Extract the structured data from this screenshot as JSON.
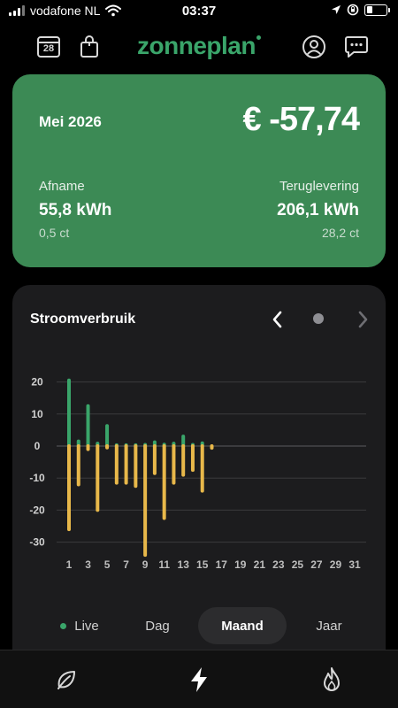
{
  "status_bar": {
    "carrier": "vodafone NL",
    "time": "03:37"
  },
  "header": {
    "calendar_day": "28",
    "logo": "zonneplan",
    "icons": [
      "calendar-icon",
      "shopping-bag-icon",
      "user-icon",
      "chat-icon"
    ]
  },
  "summary": {
    "month": "Mei 2026",
    "amount": "€ -57,74",
    "afname": {
      "label": "Afname",
      "value": "55,8 kWh",
      "sub": "0,5 ct"
    },
    "teruglevering": {
      "label": "Teruglevering",
      "value": "206,1 kWh",
      "sub": "28,2 ct"
    }
  },
  "chart": {
    "title": "Stroomverbruik"
  },
  "chart_data": {
    "type": "bar",
    "title": "Stroomverbruik",
    "x": [
      1,
      2,
      3,
      4,
      5,
      6,
      7,
      8,
      9,
      10,
      11,
      12,
      13,
      14,
      15,
      16,
      17,
      18,
      19,
      20,
      21,
      22,
      23,
      24,
      25,
      26,
      27,
      28,
      29,
      30,
      31
    ],
    "x_tick_labels": [
      "1",
      "3",
      "5",
      "7",
      "9",
      "11",
      "13",
      "15",
      "17",
      "19",
      "21",
      "23",
      "25",
      "27",
      "29",
      "31"
    ],
    "y_tick_labels": [
      "20",
      "10",
      "0",
      "-10",
      "-20",
      "-30"
    ],
    "ylim": [
      -35,
      22
    ],
    "grid": true,
    "colors": {
      "positive": "#3aa56a",
      "negative": "#e8b84a"
    },
    "series": [
      {
        "values": [
          20.5,
          1.5,
          12.5,
          0.8,
          6.3,
          0.3,
          0.3,
          0.3,
          0.4,
          1.2,
          0.5,
          0.8,
          3.0,
          0.4,
          0.9,
          0,
          null,
          null,
          null,
          null,
          null,
          null,
          null,
          null,
          null,
          null,
          null,
          null,
          null,
          null,
          null
        ]
      },
      {
        "values": [
          -26,
          -12,
          -1,
          -20,
          -0.5,
          -11.5,
          -11.5,
          -12.5,
          -34,
          -8.5,
          -22.5,
          -11.5,
          -9,
          -7.5,
          -14,
          -0.6,
          null,
          null,
          null,
          null,
          null,
          null,
          null,
          null,
          null,
          null,
          null,
          null,
          null,
          null,
          null
        ]
      }
    ]
  },
  "segments": {
    "live": "Live",
    "day": "Dag",
    "month": "Maand",
    "year": "Jaar",
    "active": "Maand"
  },
  "tabbar": {
    "icons": [
      "leaf-icon",
      "lightning-icon",
      "flame-icon"
    ]
  }
}
